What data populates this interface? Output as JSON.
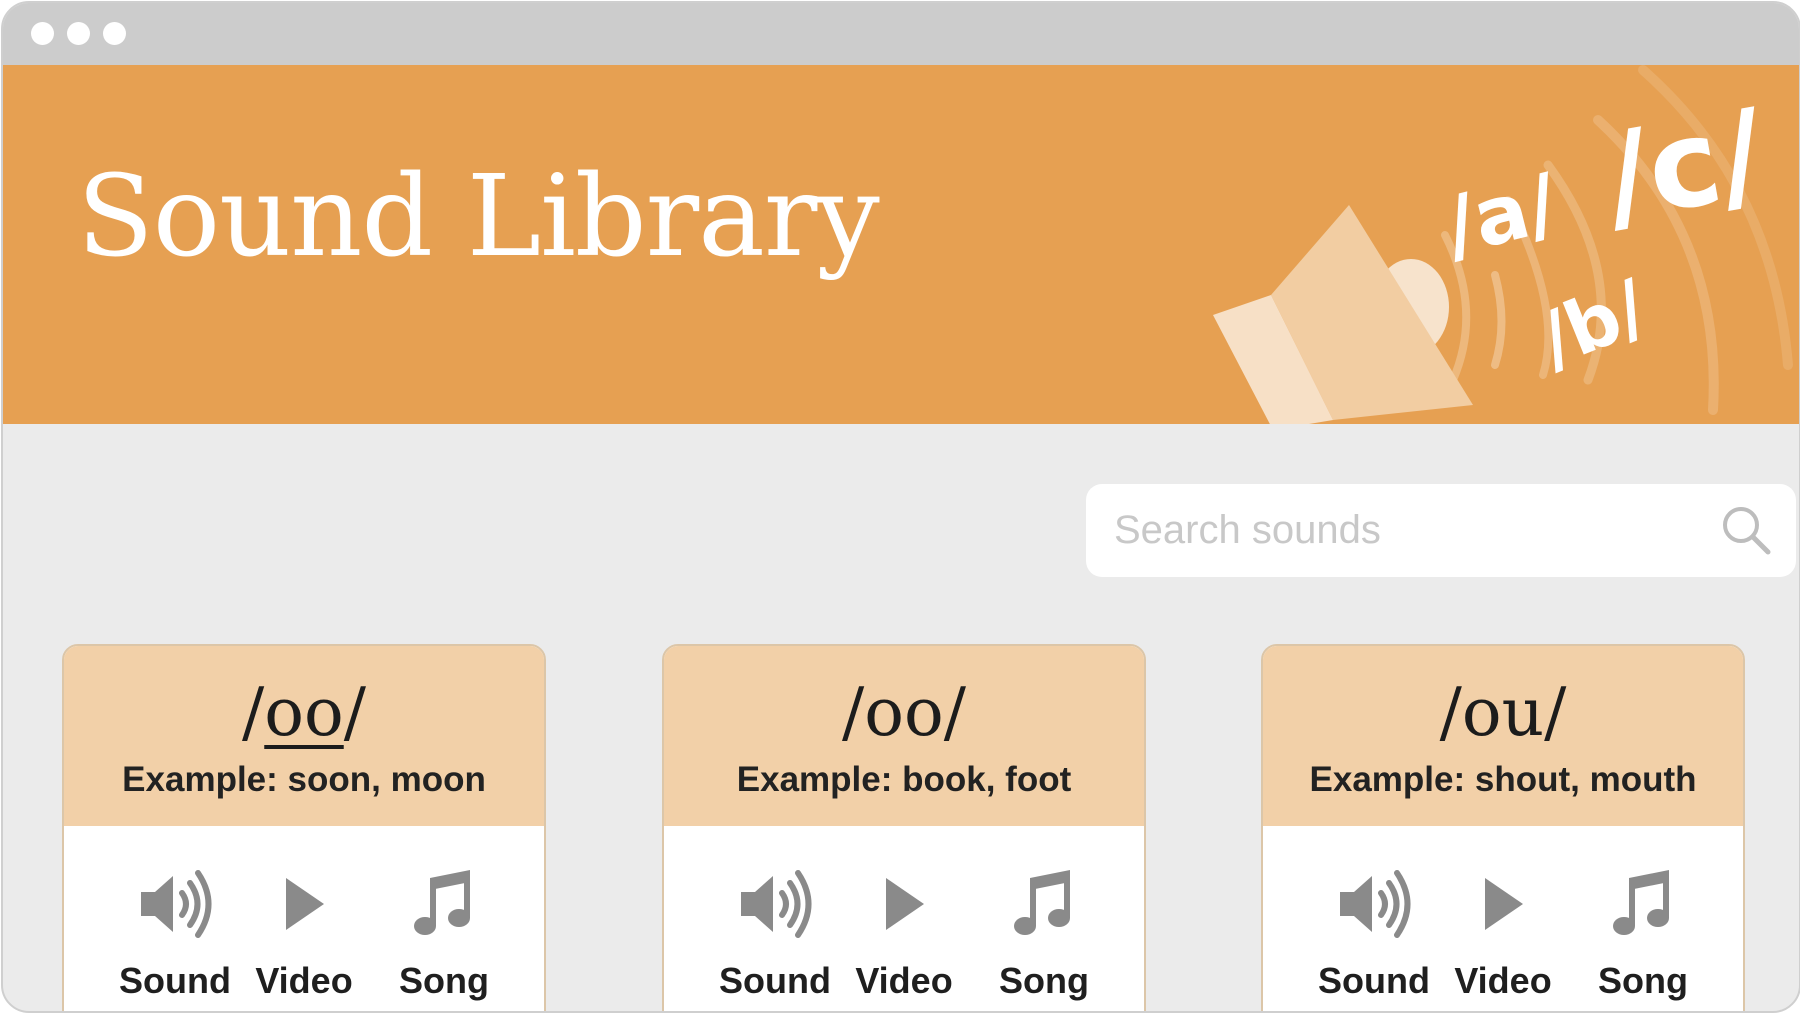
{
  "header": {
    "title": "Sound Library"
  },
  "banner_art": {
    "glyphs": [
      "/a/",
      "/b/",
      "/c/"
    ]
  },
  "search": {
    "placeholder": "Search sounds",
    "value": ""
  },
  "colors": {
    "banner": "#e6a052",
    "card_header": "#f2d0a8",
    "background": "#ebebeb",
    "icon": "#8a8a8a"
  },
  "cards": [
    {
      "symbol_open": "/",
      "symbol": "oo",
      "symbol_close": "/",
      "symbol_underlined": true,
      "example": "Example: soon, moon",
      "actions": [
        {
          "label": "Sound",
          "icon": "speaker-icon"
        },
        {
          "label": "Video",
          "icon": "play-icon"
        },
        {
          "label": "Song",
          "icon": "music-note-icon"
        }
      ]
    },
    {
      "symbol_open": "/",
      "symbol": "oo",
      "symbol_close": "/",
      "symbol_underlined": false,
      "example": "Example: book, foot",
      "actions": [
        {
          "label": "Sound",
          "icon": "speaker-icon"
        },
        {
          "label": "Video",
          "icon": "play-icon"
        },
        {
          "label": "Song",
          "icon": "music-note-icon"
        }
      ]
    },
    {
      "symbol_open": "/",
      "symbol": "ou",
      "symbol_close": "/",
      "symbol_underlined": false,
      "example": "Example: shout, mouth",
      "actions": [
        {
          "label": "Sound",
          "icon": "speaker-icon"
        },
        {
          "label": "Video",
          "icon": "play-icon"
        },
        {
          "label": "Song",
          "icon": "music-note-icon"
        }
      ]
    }
  ]
}
